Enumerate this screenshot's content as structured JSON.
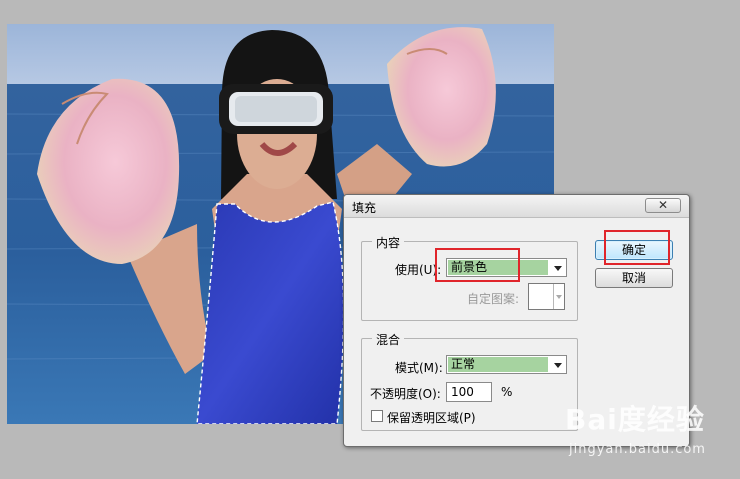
{
  "dialog": {
    "title": "填充",
    "close_glyph": "✕",
    "content_group": {
      "label": "内容",
      "use_label": "使用(U):",
      "use_value": "前景色",
      "custom_pattern_label": "自定图案:"
    },
    "blend_group": {
      "label": "混合",
      "mode_label": "模式(M):",
      "mode_value": "正常",
      "opacity_label": "不透明度(O):",
      "opacity_value": "100",
      "opacity_unit": "%",
      "preserve_label": "保留透明区域(P)"
    },
    "ok_label": "确定",
    "cancel_label": "取消"
  },
  "watermark": {
    "brand": "Bai度经验",
    "url": "jingyan.baidu.com"
  },
  "colors": {
    "accent_highlight": "#e0252b",
    "select_fill": "#a6d3a0",
    "swimsuit": "#2c3bb7"
  },
  "icons": {
    "close": "close-icon",
    "dropdown": "chevron-down-icon",
    "watermark": "paw-icon"
  }
}
